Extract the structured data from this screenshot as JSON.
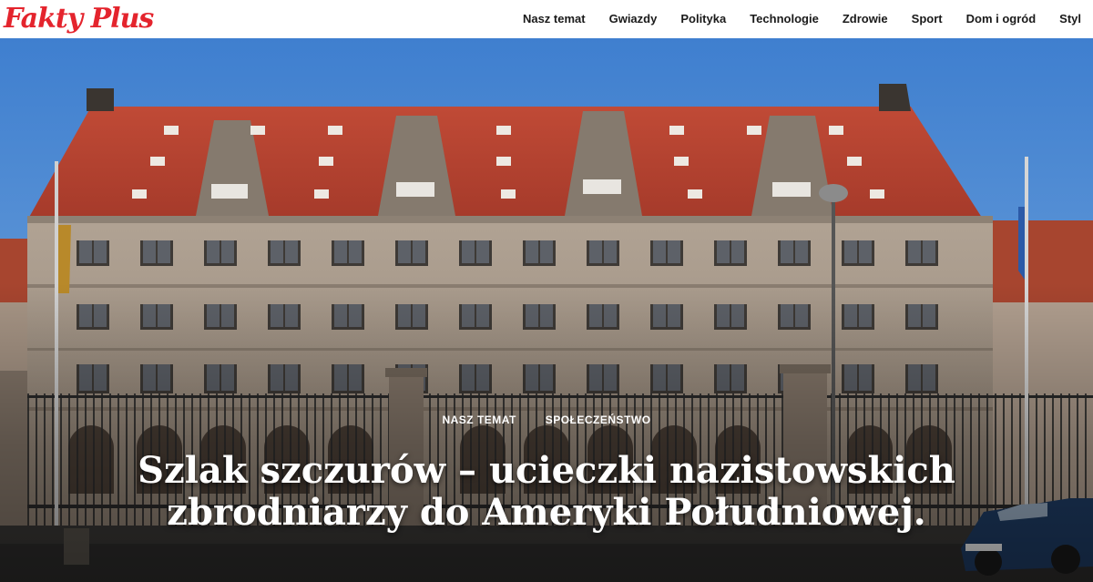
{
  "site": {
    "logo": "Fakty Plus",
    "brand_color": "#e4242d"
  },
  "nav": {
    "items": [
      {
        "label": "Nasz temat"
      },
      {
        "label": "Gwiazdy"
      },
      {
        "label": "Polityka"
      },
      {
        "label": "Technologie"
      },
      {
        "label": "Zdrowie"
      },
      {
        "label": "Sport"
      },
      {
        "label": "Dom i ogród"
      },
      {
        "label": "Styl"
      }
    ]
  },
  "article": {
    "categories": [
      "NASZ TEMAT",
      "SPOŁECZEŃSTWO"
    ],
    "title_line1": "Szlak szczurów – ucieczki nazistowskich",
    "title_line2": "zbrodniarzy do Ameryki Południowej.",
    "hero_image": "courthouse-building-photo"
  },
  "colors": {
    "sky": "#4a86d0",
    "roof": "#b8412f",
    "stone": "#a39486",
    "text": "#1a1a1a"
  }
}
